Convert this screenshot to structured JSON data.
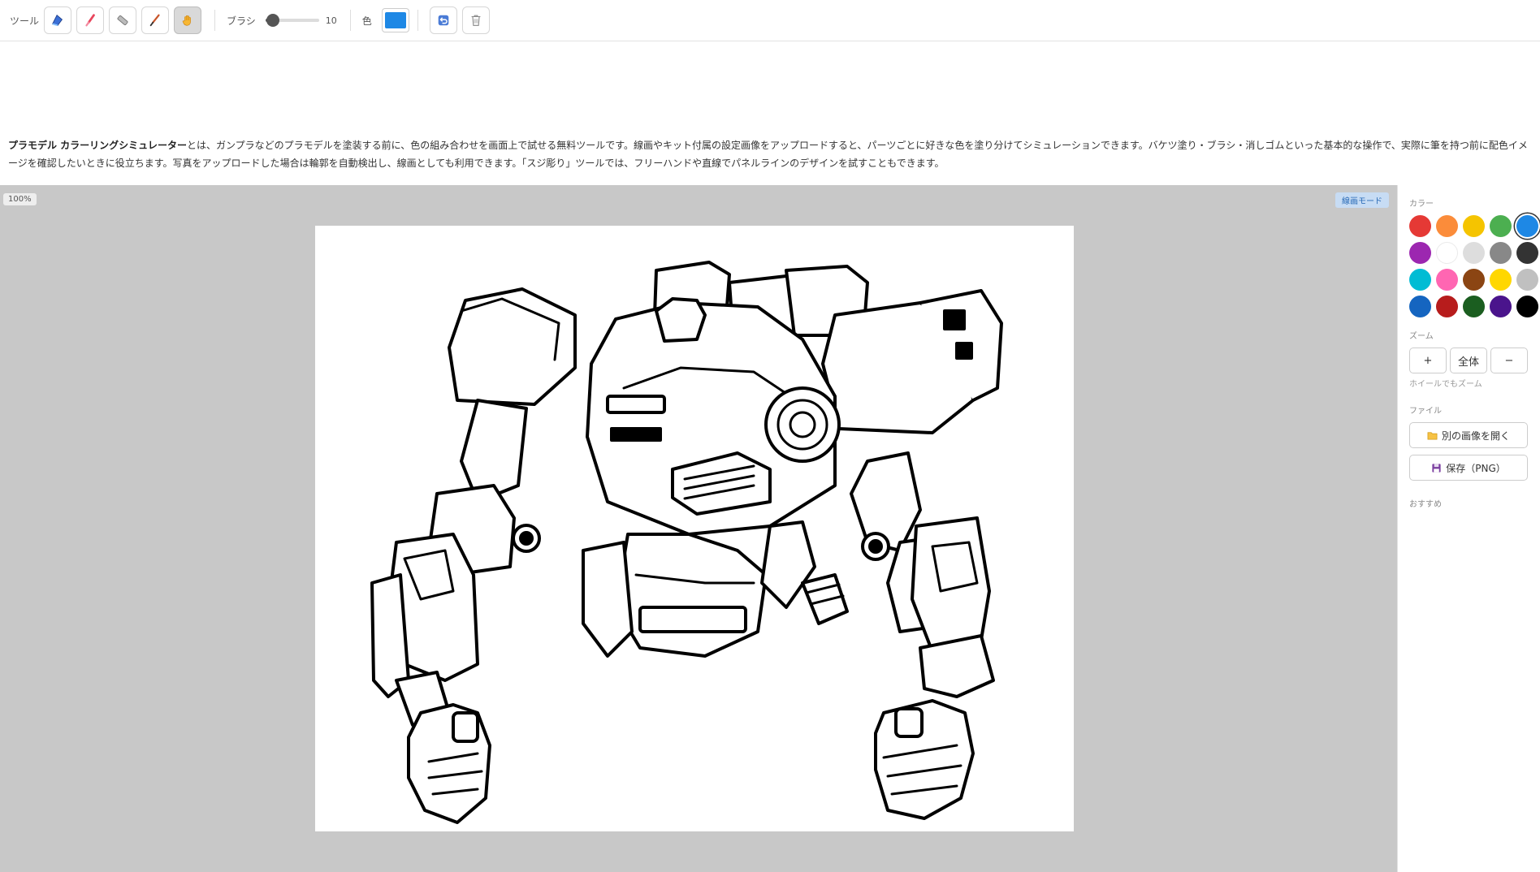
{
  "toolbar": {
    "tool_label": "ツール",
    "tools": [
      {
        "name": "bucket-tool",
        "icon": "paint-bucket-icon",
        "active": false
      },
      {
        "name": "brush-tool",
        "icon": "brush-icon",
        "active": false
      },
      {
        "name": "eraser-tool",
        "icon": "eraser-icon",
        "active": false
      },
      {
        "name": "suji-bori-tool",
        "icon": "scribe-pen-icon",
        "active": false
      },
      {
        "name": "pan-tool",
        "icon": "hand-icon",
        "active": true
      }
    ],
    "brush_label": "ブラシ",
    "brush_value": "10",
    "brush_fraction": 0.1,
    "color_label": "色",
    "current_color": "#1e88e5",
    "undo_icon": "undo-icon",
    "clear_icon": "trash-icon"
  },
  "description": {
    "title": "プラモデル カラーリングシミュレーター",
    "body": "とは、ガンプラなどのプラモデルを塗装する前に、色の組み合わせを画面上で試せる無料ツールです。線画やキット付属の設定画像をアップロードすると、パーツごとに好きな色を塗り分けてシミュレーションできます。バケツ塗り・ブラシ・消しゴムといった基本的な操作で、実際に筆を持つ前に配色イメージを確認したいときに役立ちます。写真をアップロードした場合は輪郭を自動検出し、線画としても利用できます。「スジ彫り」ツールでは、フリーハンドや直線でパネルラインのデザインを試すこともできます。"
  },
  "canvas": {
    "zoom_label": "100%",
    "mode_label": "線画モード"
  },
  "panel": {
    "color_title": "カラー",
    "colors": [
      "#e53935",
      "#fb8c3a",
      "#f5c400",
      "#4caf50",
      "#1e88e5",
      "#9c27b0",
      "#ffffff",
      "#dddddd",
      "#888888",
      "#333333",
      "#00bcd4",
      "#ff66b2",
      "#8b4513",
      "#ffd700",
      "#c0c0c0",
      "#1565c0",
      "#b71c1c",
      "#1b5e20",
      "#4a148c",
      "#000000"
    ],
    "selected_color": "#1e88e5",
    "zoom_title": "ズーム",
    "zoom_in": "+",
    "zoom_fit": "全体",
    "zoom_out": "−",
    "zoom_hint": "ホイールでもズーム",
    "file_title": "ファイル",
    "open_label": "別の画像を開く",
    "save_label": "保存（PNG）",
    "recommend_title": "おすすめ"
  }
}
